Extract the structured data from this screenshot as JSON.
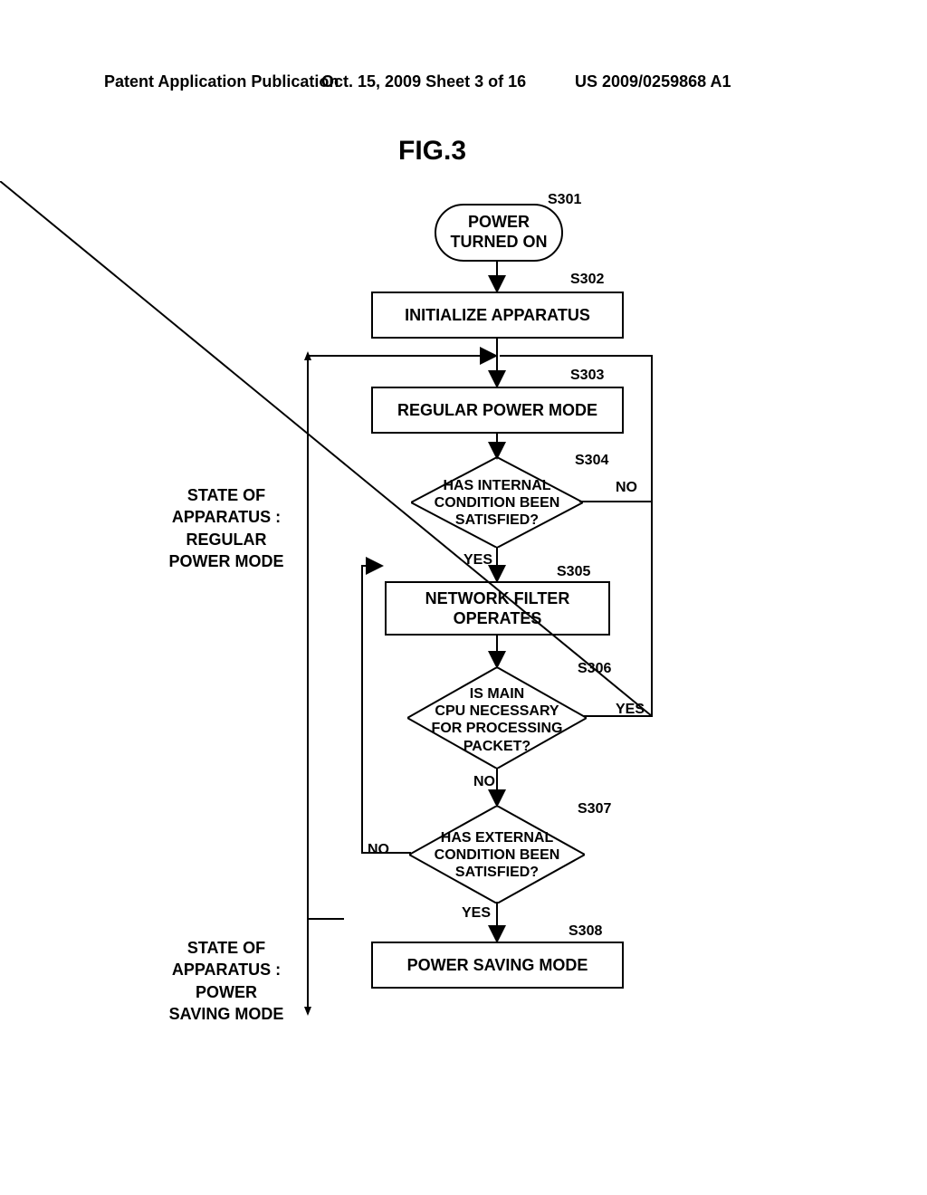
{
  "header": {
    "left": "Patent Application Publication",
    "center": "Oct. 15, 2009   Sheet 3 of 16",
    "right": "US 2009/0259868 A1"
  },
  "figure_title": "FIG.3",
  "steps": {
    "s301": "S301",
    "s302": "S302",
    "s303": "S303",
    "s304": "S304",
    "s305": "S305",
    "s306": "S306",
    "s307": "S307",
    "s308": "S308"
  },
  "nodes": {
    "s301_text": "POWER\nTURNED ON",
    "s302_text": "INITIALIZE APPARATUS",
    "s303_text": "REGULAR POWER MODE",
    "s304_text": "HAS INTERNAL\nCONDITION BEEN\nSATISFIED?",
    "s305_text": "NETWORK FILTER\nOPERATES",
    "s306_text": "IS MAIN\nCPU NECESSARY\nFOR PROCESSING\nPACKET?",
    "s307_text": "HAS EXTERNAL\nCONDITION BEEN\nSATISFIED?",
    "s308_text": "POWER SAVING MODE"
  },
  "branches": {
    "s304_yes": "YES",
    "s304_no": "NO",
    "s306_yes": "YES",
    "s306_no": "NO",
    "s307_yes": "YES",
    "s307_no": "NO"
  },
  "side": {
    "regular": "STATE OF\nAPPARATUS :\nREGULAR\nPOWER MODE",
    "saving": "STATE OF\nAPPARATUS :\nPOWER\nSAVING MODE"
  },
  "chart_data": {
    "type": "flowchart",
    "nodes": [
      {
        "id": "S301",
        "type": "terminal",
        "label": "POWER TURNED ON"
      },
      {
        "id": "S302",
        "type": "process",
        "label": "INITIALIZE APPARATUS"
      },
      {
        "id": "S303",
        "type": "process",
        "label": "REGULAR POWER MODE"
      },
      {
        "id": "S304",
        "type": "decision",
        "label": "HAS INTERNAL CONDITION BEEN SATISFIED?"
      },
      {
        "id": "S305",
        "type": "process",
        "label": "NETWORK FILTER OPERATES"
      },
      {
        "id": "S306",
        "type": "decision",
        "label": "IS MAIN CPU NECESSARY FOR PROCESSING PACKET?"
      },
      {
        "id": "S307",
        "type": "decision",
        "label": "HAS EXTERNAL CONDITION BEEN SATISFIED?"
      },
      {
        "id": "S308",
        "type": "process",
        "label": "POWER SAVING MODE"
      }
    ],
    "edges": [
      {
        "from": "S301",
        "to": "S302"
      },
      {
        "from": "S302",
        "to": "S303"
      },
      {
        "from": "S303",
        "to": "S304"
      },
      {
        "from": "S304",
        "to": "S305",
        "label": "YES"
      },
      {
        "from": "S304",
        "to": "S303",
        "label": "NO"
      },
      {
        "from": "S305",
        "to": "S306"
      },
      {
        "from": "S306",
        "to": "S307",
        "label": "NO"
      },
      {
        "from": "S306",
        "to": "S303",
        "label": "YES"
      },
      {
        "from": "S307",
        "to": "S308",
        "label": "YES"
      },
      {
        "from": "S307",
        "to": "S305",
        "label": "NO"
      }
    ],
    "groups": [
      {
        "label": "STATE OF APPARATUS: REGULAR POWER MODE",
        "contains": [
          "S303",
          "S304",
          "S305",
          "S306",
          "S307"
        ]
      },
      {
        "label": "STATE OF APPARATUS: POWER SAVING MODE",
        "contains": [
          "S308"
        ]
      }
    ],
    "title": "FIG.3"
  }
}
